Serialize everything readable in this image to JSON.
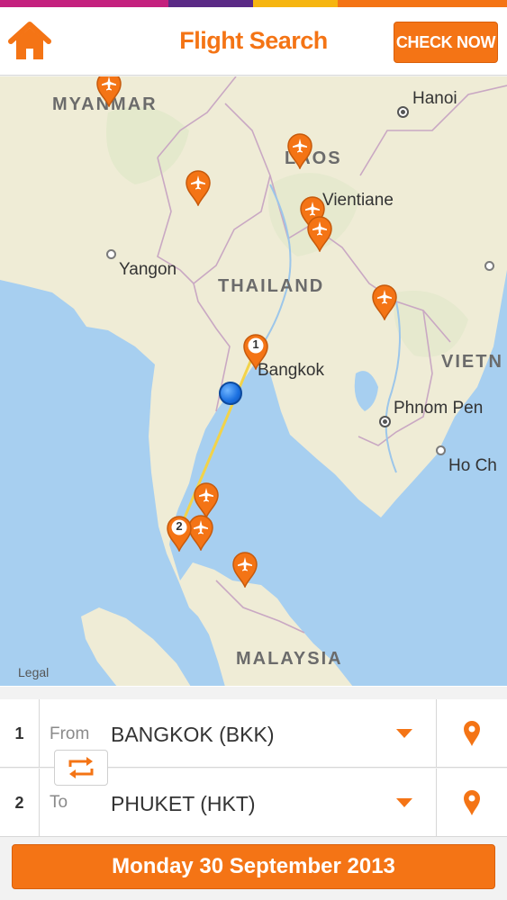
{
  "header": {
    "title": "Flight Search",
    "check_now_label": "CHECK NOW",
    "home_icon": "home-icon",
    "stripe_colors": [
      "#c4217e",
      "#5b2a86",
      "#f6b510",
      "#f47415"
    ]
  },
  "map": {
    "countries": {
      "myanmar": "MYANMAR",
      "laos": "LAOS",
      "thailand": "THAILAND",
      "vietnam": "VIETN",
      "malaysia": "MALAYSIA"
    },
    "cities": {
      "hanoi": "Hanoi",
      "vientiane": "Vientiane",
      "yangon": "Yangon",
      "bangkok": "Bangkok",
      "phnom_penh": "Phnom Pen",
      "ho_chi_minh": "Ho Ch"
    },
    "route_markers": {
      "origin": "1",
      "destination": "2"
    },
    "legal": "Legal"
  },
  "form": {
    "rows": [
      {
        "number": "1",
        "label": "From",
        "value": "BANGKOK (BKK)"
      },
      {
        "number": "2",
        "label": "To",
        "value": "PHUKET (HKT)"
      }
    ],
    "date_label": "Monday 30 September 2013"
  },
  "colors": {
    "accent": "#f47415",
    "sea": "#a7cff0",
    "land": "#efecd6"
  }
}
